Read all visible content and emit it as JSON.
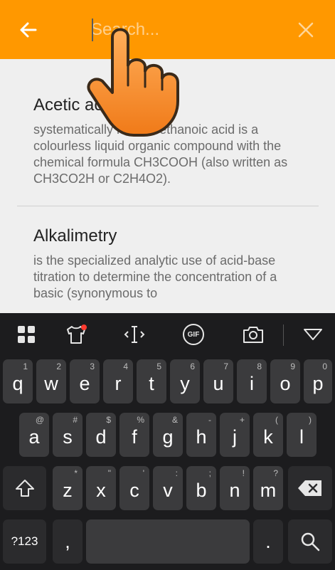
{
  "search": {
    "placeholder": "Search..."
  },
  "results": [
    {
      "title": "Acetic ac",
      "description": "systematically named ethanoic acid is a colourless liquid organic compound with the chemical formula CH3COOH (also written as CH3CO2H or C2H4O2)."
    },
    {
      "title": "Alkalimetry",
      "description": "is the specialized analytic use of acid-base titration to determine the concentration of a basic (synonymous to"
    }
  ],
  "keyboard": {
    "row1": [
      {
        "label": "q",
        "hint": "1"
      },
      {
        "label": "w",
        "hint": "2"
      },
      {
        "label": "e",
        "hint": "3"
      },
      {
        "label": "r",
        "hint": "4"
      },
      {
        "label": "t",
        "hint": "5"
      },
      {
        "label": "y",
        "hint": "6"
      },
      {
        "label": "u",
        "hint": "7"
      },
      {
        "label": "i",
        "hint": "8"
      },
      {
        "label": "o",
        "hint": "9"
      },
      {
        "label": "p",
        "hint": "0"
      }
    ],
    "row2": [
      {
        "label": "a",
        "hint": "@"
      },
      {
        "label": "s",
        "hint": "#"
      },
      {
        "label": "d",
        "hint": "$"
      },
      {
        "label": "f",
        "hint": "%"
      },
      {
        "label": "g",
        "hint": "&"
      },
      {
        "label": "h",
        "hint": "-"
      },
      {
        "label": "j",
        "hint": "+"
      },
      {
        "label": "k",
        "hint": "("
      },
      {
        "label": "l",
        "hint": ")"
      }
    ],
    "row3": [
      {
        "label": "z",
        "hint": "*"
      },
      {
        "label": "x",
        "hint": "\""
      },
      {
        "label": "c",
        "hint": "'"
      },
      {
        "label": "v",
        "hint": ":"
      },
      {
        "label": "b",
        "hint": ";"
      },
      {
        "label": "n",
        "hint": "!"
      },
      {
        "label": "m",
        "hint": "?"
      }
    ],
    "symbols_label": "?123",
    "comma_label": ",",
    "period_label": ".",
    "gif_label": "GIF"
  },
  "colors": {
    "accent": "#ff9800",
    "keyboard_bg": "#1c1c1e",
    "key_bg": "#3b3b3d"
  }
}
